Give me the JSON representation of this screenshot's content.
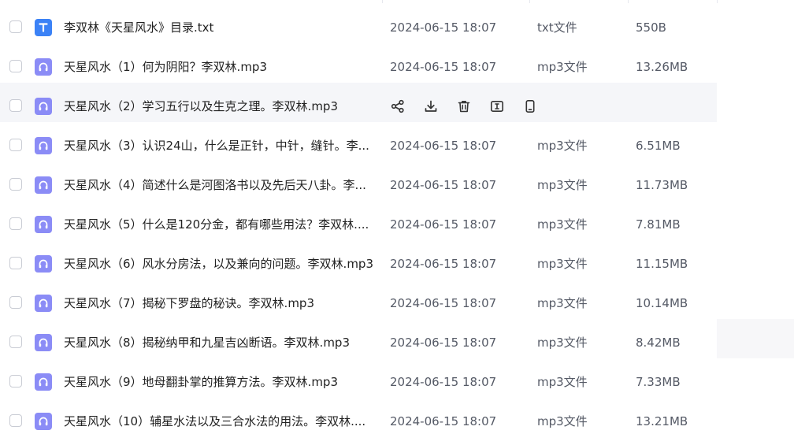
{
  "files": [
    {
      "name": "李双林《天星风水》目录.txt",
      "date": "2024-06-15 18:07",
      "type": "txt文件",
      "size": "550B",
      "icon": "txt-file-icon"
    },
    {
      "name": "天星风水（1）何为阴阳？李双林.mp3",
      "date": "2024-06-15 18:07",
      "type": "mp3文件",
      "size": "13.26MB",
      "icon": "audio-file-icon"
    },
    {
      "name": "天星风水（2）学习五行以及生克之理。李双林.mp3",
      "date": "",
      "type": "",
      "size": "",
      "icon": "audio-file-icon",
      "hovered": true
    },
    {
      "name": "天星风水（3）认识24山，什么是正针，中针，缝针。李...",
      "date": "2024-06-15 18:07",
      "type": "mp3文件",
      "size": "6.51MB",
      "icon": "audio-file-icon"
    },
    {
      "name": "天星风水（4）简述什么是河图洛书以及先后天八卦。李...",
      "date": "2024-06-15 18:07",
      "type": "mp3文件",
      "size": "11.73MB",
      "icon": "audio-file-icon"
    },
    {
      "name": "天星风水（5）什么是120分金，都有哪些用法？李双林....",
      "date": "2024-06-15 18:07",
      "type": "mp3文件",
      "size": "7.81MB",
      "icon": "audio-file-icon"
    },
    {
      "name": "天星风水（6）风水分房法，以及兼向的问题。李双林.mp3",
      "date": "2024-06-15 18:07",
      "type": "mp3文件",
      "size": "11.15MB",
      "icon": "audio-file-icon"
    },
    {
      "name": "天星风水（7）揭秘下罗盘的秘诀。李双林.mp3",
      "date": "2024-06-15 18:07",
      "type": "mp3文件",
      "size": "10.14MB",
      "icon": "audio-file-icon"
    },
    {
      "name": "天星风水（8）揭秘纳甲和九星吉凶断语。李双林.mp3",
      "date": "2024-06-15 18:07",
      "type": "mp3文件",
      "size": "8.42MB",
      "icon": "audio-file-icon"
    },
    {
      "name": "天星风水（9）地母翻卦掌的推算方法。李双林.mp3",
      "date": "2024-06-15 18:07",
      "type": "mp3文件",
      "size": "7.33MB",
      "icon": "audio-file-icon"
    },
    {
      "name": "天星风水（10）辅星水法以及三合水法的用法。李双林....",
      "date": "2024-06-15 18:07",
      "type": "mp3文件",
      "size": "13.21MB",
      "icon": "audio-file-icon"
    }
  ],
  "hover_actions": [
    {
      "icon": "share-icon"
    },
    {
      "icon": "download-icon"
    },
    {
      "icon": "delete-icon"
    },
    {
      "icon": "rename-icon"
    },
    {
      "icon": "mobile-icon"
    }
  ],
  "colors": {
    "txt_icon": "#3b82f6",
    "audio_icon": "#8b8cf6",
    "hover_row": "#f5f6f9",
    "secondary_text": "#555a66"
  }
}
